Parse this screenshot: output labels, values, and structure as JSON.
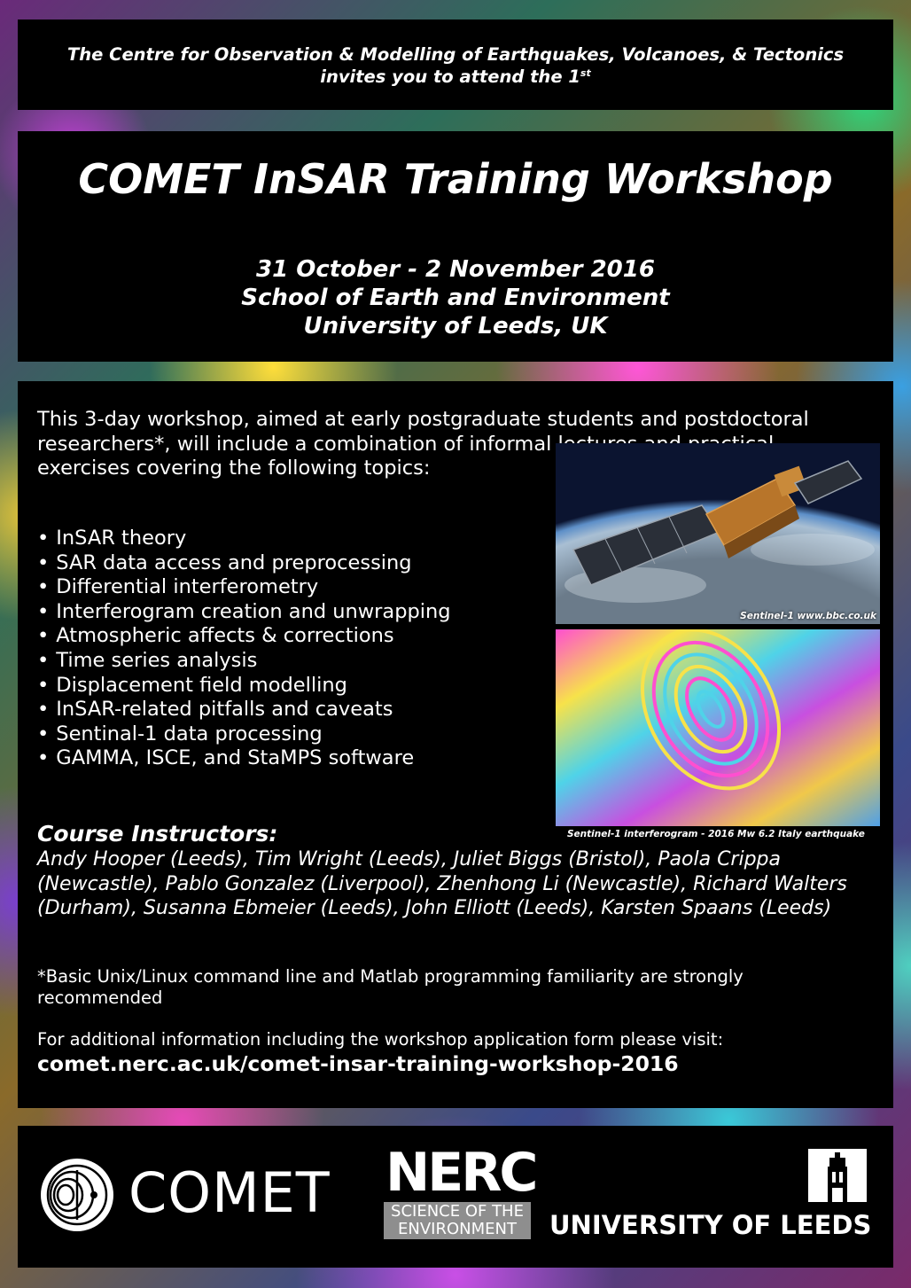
{
  "header": {
    "line1": "The Centre for Observation & Modelling of Earthquakes, Volcanoes, & Tectonics",
    "line2": "invites you to attend the 1",
    "line2_sup": "st"
  },
  "title": {
    "main": "COMET InSAR Training Workshop",
    "dates": "31 October - 2 November 2016",
    "venue": "School of Earth and Environment",
    "institution": "University of Leeds, UK"
  },
  "body": {
    "intro": "This 3-day workshop, aimed at early postgraduate students and postdoctoral researchers*, will include a combination of informal lectures and practical exercises covering the following topics:",
    "topics": [
      "InSAR theory",
      "SAR data access and preprocessing",
      "Differential interferometry",
      "Interferogram creation and unwrapping",
      "Atmospheric affects & corrections",
      "Time series analysis",
      "Displacement field modelling",
      "InSAR-related pitfalls and caveats",
      "Sentinal-1 data processing",
      "GAMMA, ISCE, and StaMPS software"
    ],
    "satellite_credit": "Sentinel-1 www.bbc.co.uk",
    "interferogram_credit": "Sentinel-1 interferogram - 2016 Mw 6.2 Italy earthquake",
    "instructors_heading": "Course Instructors:",
    "instructors": "Andy Hooper (Leeds), Tim Wright (Leeds), Juliet Biggs (Bristol), Paola Crippa (Newcastle), Pablo Gonzalez (Liverpool), Zhenhong Li (Newcastle), Richard Walters (Durham), Susanna Ebmeier (Leeds), John Elliott (Leeds), Karsten Spaans (Leeds)",
    "requirements": "*Basic Unix/Linux command line and Matlab programming familiarity are strongly recommended",
    "more_info": "For additional information including the workshop application form please visit:",
    "url": "comet.nerc.ac.uk/comet-insar-training-workshop-2016"
  },
  "footer": {
    "comet": "COMET",
    "nerc": "NERC",
    "nerc_sub1": "SCIENCE OF THE",
    "nerc_sub2": "ENVIRONMENT",
    "leeds": "UNIVERSITY OF LEEDS"
  }
}
